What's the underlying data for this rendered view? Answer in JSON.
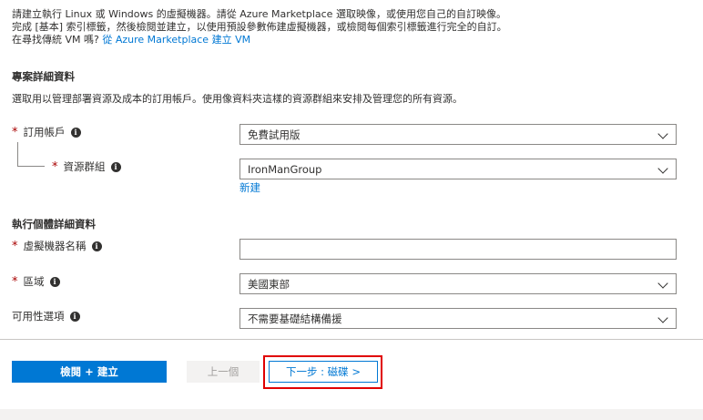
{
  "intro": {
    "line1": "請建立執行 Linux 或 Windows 的虛擬機器。請從 Azure Marketplace 選取映像，或使用您自己的自訂映像。",
    "line2": "完成 [基本] 索引標籤，然後檢閱並建立，以使用預設參數佈建虛擬機器，或檢閱每個索引標籤進行完全的自訂。",
    "line3_text": "在尋找傳統 VM 嗎?",
    "line3_link": "從 Azure Marketplace 建立 VM"
  },
  "project": {
    "title": "專案詳細資料",
    "desc": "選取用以管理部署資源及成本的訂用帳戶。使用像資料夾這樣的資源群組來安排及管理您的所有資源。",
    "subscription": {
      "label": "訂用帳戶",
      "value": "免費試用版"
    },
    "resource_group": {
      "label": "資源群組",
      "value": "IronManGroup",
      "new_link": "新建"
    }
  },
  "instance": {
    "title": "執行個體詳細資料",
    "vm_name": {
      "label": "虛擬機器名稱",
      "value": ""
    },
    "region": {
      "label": "區域",
      "value": "美國東部"
    },
    "availability": {
      "label": "可用性選項",
      "value": "不需要基礎結構備援"
    }
  },
  "buttons": {
    "review_create": "檢閱 + 建立",
    "previous": "上一個",
    "next": "下一步 : 磁碟 >"
  },
  "colors": {
    "accent": "#0078d4",
    "required": "#a80000",
    "highlight": "#e00000"
  }
}
